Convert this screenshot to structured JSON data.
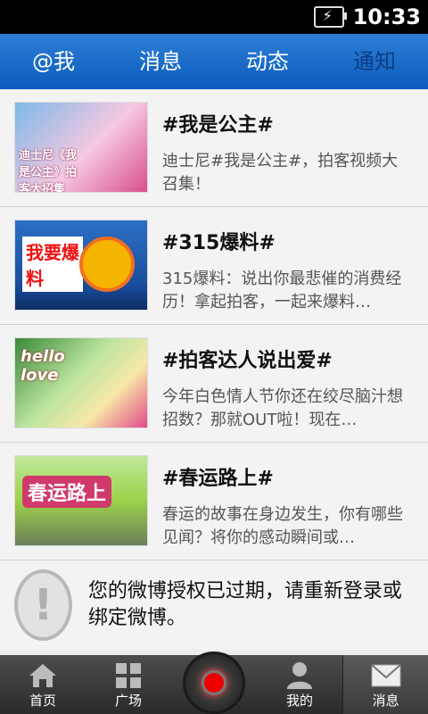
{
  "status": {
    "time": "10:33"
  },
  "tabs": [
    {
      "label": "@我"
    },
    {
      "label": "消息"
    },
    {
      "label": "动态"
    },
    {
      "label": "通知"
    }
  ],
  "items": [
    {
      "title": "#我是公主#",
      "desc": "迪士尼#我是公主#，拍客视频大召集！",
      "thumb_text": "迪士尼《我是公主》拍客大招集",
      "thumb_colors": [
        "#7db9e8",
        "#d84f8c"
      ]
    },
    {
      "title": "#315爆料#",
      "desc": "315爆料：说出你最悲催的消费经历！拿起拍客，一起来爆料…",
      "thumb_text": "我要爆料",
      "thumb_colors": [
        "#ffffff",
        "#1b4fa0"
      ]
    },
    {
      "title": "#拍客达人说出爱#",
      "desc": "今年白色情人节你还在绞尽脑汁想招数？那就OUT啦！现在…",
      "thumb_text": "hello love",
      "thumb_colors": [
        "#3a8a3a",
        "#e34a8a"
      ]
    },
    {
      "title": "#春运路上#",
      "desc": "春运的故事在身边发生，你有哪些见闻？将你的感动瞬间或…",
      "thumb_text": "春运路上",
      "thumb_colors": [
        "#9bd24a",
        "#d03a6a"
      ]
    }
  ],
  "notice": {
    "text": "您的微博授权已过期，请重新登录或绑定微博。"
  },
  "nav": [
    {
      "label": "首页",
      "icon": "home-icon"
    },
    {
      "label": "广场",
      "icon": "grid-icon"
    },
    {
      "label": "",
      "icon": "record-icon"
    },
    {
      "label": "我的",
      "icon": "person-icon"
    },
    {
      "label": "消息",
      "icon": "mail-icon"
    }
  ]
}
